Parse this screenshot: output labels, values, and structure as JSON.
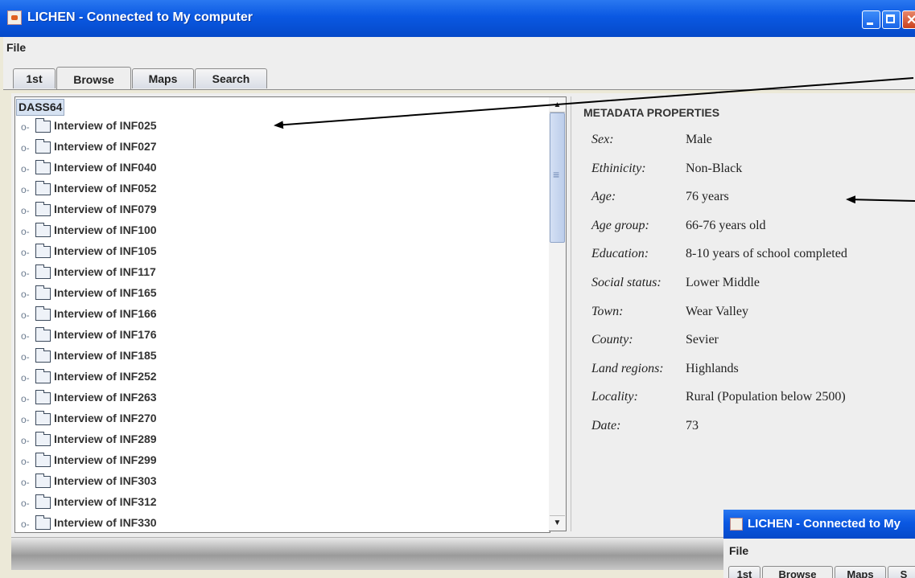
{
  "window": {
    "title": "LICHEN - Connected to My computer"
  },
  "menu": {
    "file": "File"
  },
  "tabs": [
    "1st",
    "Browse",
    "Maps",
    "Search"
  ],
  "tree": {
    "root": "DASS64",
    "items": [
      "Interview of INF025",
      "Interview of INF027",
      "Interview of INF040",
      "Interview of INF052",
      "Interview of INF079",
      "Interview of INF100",
      "Interview of INF105",
      "Interview of INF117",
      "Interview of INF165",
      "Interview of INF166",
      "Interview of INF176",
      "Interview of INF185",
      "Interview of INF252",
      "Interview of INF263",
      "Interview of INF270",
      "Interview of INF289",
      "Interview of INF299",
      "Interview of INF303",
      "Interview of INF312",
      "Interview of INF330"
    ]
  },
  "metadata": {
    "title": "METADATA PROPERTIES",
    "properties": [
      {
        "label": "Sex:",
        "value": "Male"
      },
      {
        "label": "Ethinicity:",
        "value": "Non-Black"
      },
      {
        "label": "Age:",
        "value": "76 years"
      },
      {
        "label": "Age group:",
        "value": "66-76 years old"
      },
      {
        "label": "Education:",
        "value": "8-10 years of school completed"
      },
      {
        "label": "Social status:",
        "value": "Lower Middle"
      },
      {
        "label": "Town:",
        "value": "Wear Valley"
      },
      {
        "label": "County:",
        "value": "Sevier"
      },
      {
        "label": "Land regions:",
        "value": "Highlands"
      },
      {
        "label": "Locality:",
        "value": "Rural (Population below 2500)"
      },
      {
        "label": "Date:",
        "value": "73"
      }
    ]
  },
  "second_window": {
    "title": "LICHEN - Connected to My",
    "menu_file": "File",
    "tabs": [
      "1st",
      "Browse",
      "Maps",
      "S"
    ]
  }
}
